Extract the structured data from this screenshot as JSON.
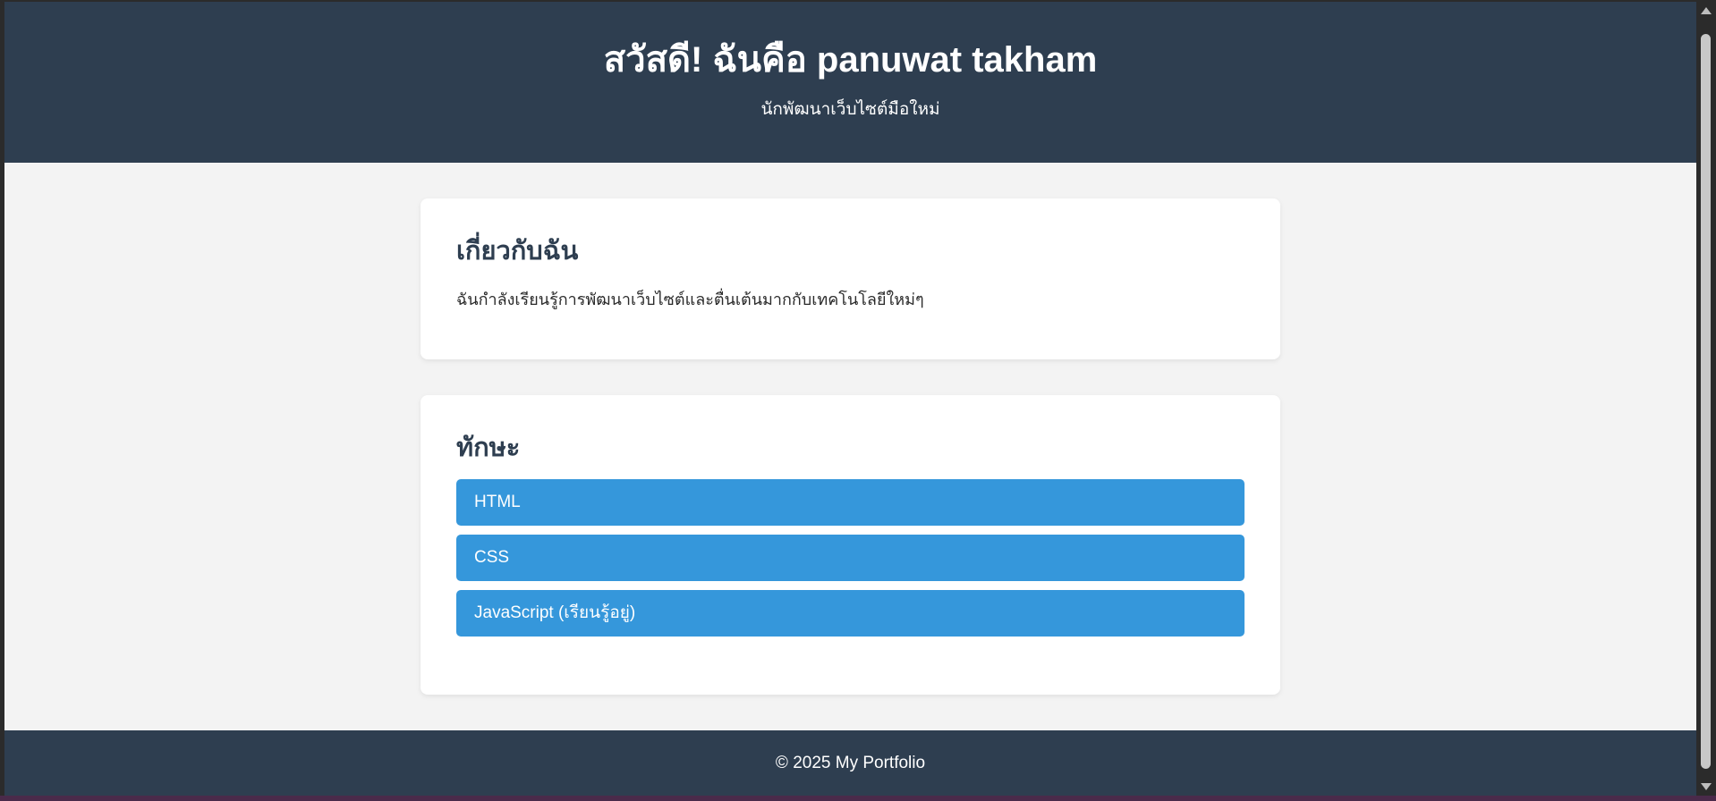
{
  "header": {
    "title": "สวัสดี! ฉันคือ panuwat takham",
    "subtitle": "นักพัฒนาเว็บไซต์มือใหม่"
  },
  "about": {
    "heading": "เกี่ยวกับฉัน",
    "text": "ฉันกำลังเรียนรู้การพัฒนาเว็บไซต์และตื่นเต้นมากกับเทคโนโลยีใหม่ๆ"
  },
  "skills": {
    "heading": "ทักษะ",
    "items": [
      {
        "label": "HTML"
      },
      {
        "label": "CSS"
      },
      {
        "label": "JavaScript (เรียนรู้อยู่)"
      }
    ]
  },
  "footer": {
    "text": "© 2025 My Portfolio"
  },
  "colors": {
    "header_bg": "#2e3e50",
    "page_bg": "#f3f3f3",
    "skill_bg": "#3597db",
    "card_bg": "#ffffff"
  }
}
